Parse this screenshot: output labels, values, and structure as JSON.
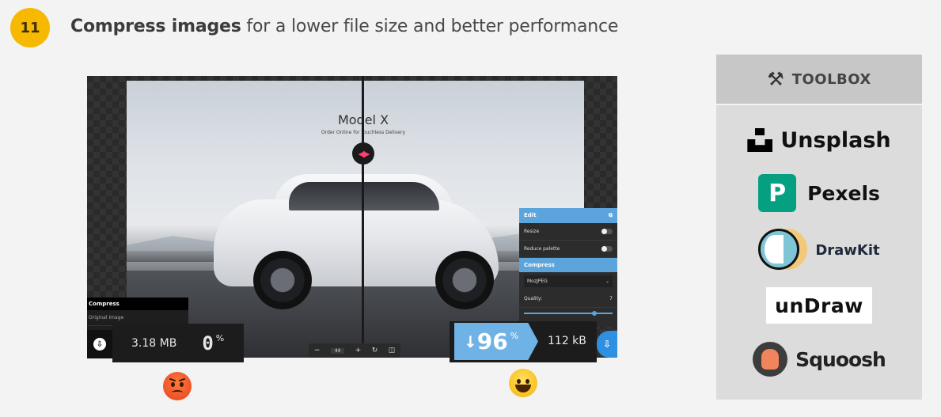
{
  "header": {
    "step_number": "11",
    "title_bold": "Compress images",
    "title_rest": " for a lower file size and better performance"
  },
  "editor": {
    "preview": {
      "title": "Model X",
      "subtitle": "Order Online for Touchless Delivery"
    },
    "zoom": {
      "minus": "−",
      "value": "44",
      "plus": "+"
    },
    "left_panel": {
      "header": "Compress",
      "row": "Original Image"
    },
    "edit_panel": {
      "header": "Edit",
      "resize_label": "Resize",
      "reduce_palette_label": "Reduce palette",
      "compress_header": "Compress",
      "codec_value": "MozJPEG",
      "quality_label": "Quality:",
      "quality_value": "7"
    },
    "left_stats": {
      "size": "3.18 MB",
      "percent": "0",
      "percent_sym": "%"
    },
    "right_stats": {
      "arrow": "↓",
      "percent": "96",
      "percent_sym": "%",
      "size": "112 kB"
    }
  },
  "toolbox": {
    "header": "TOOLBOX",
    "icon": "tools-icon",
    "tools": {
      "unsplash": "Unsplash",
      "pexels": "Pexels",
      "pexels_mark": "P",
      "drawkit": "DrawKit",
      "undraw": "unDraw",
      "squoosh": "Squoosh"
    }
  },
  "colors": {
    "badge": "#f6b800",
    "accent_blue": "#6fb2e6",
    "pexels_green": "#05a081"
  }
}
